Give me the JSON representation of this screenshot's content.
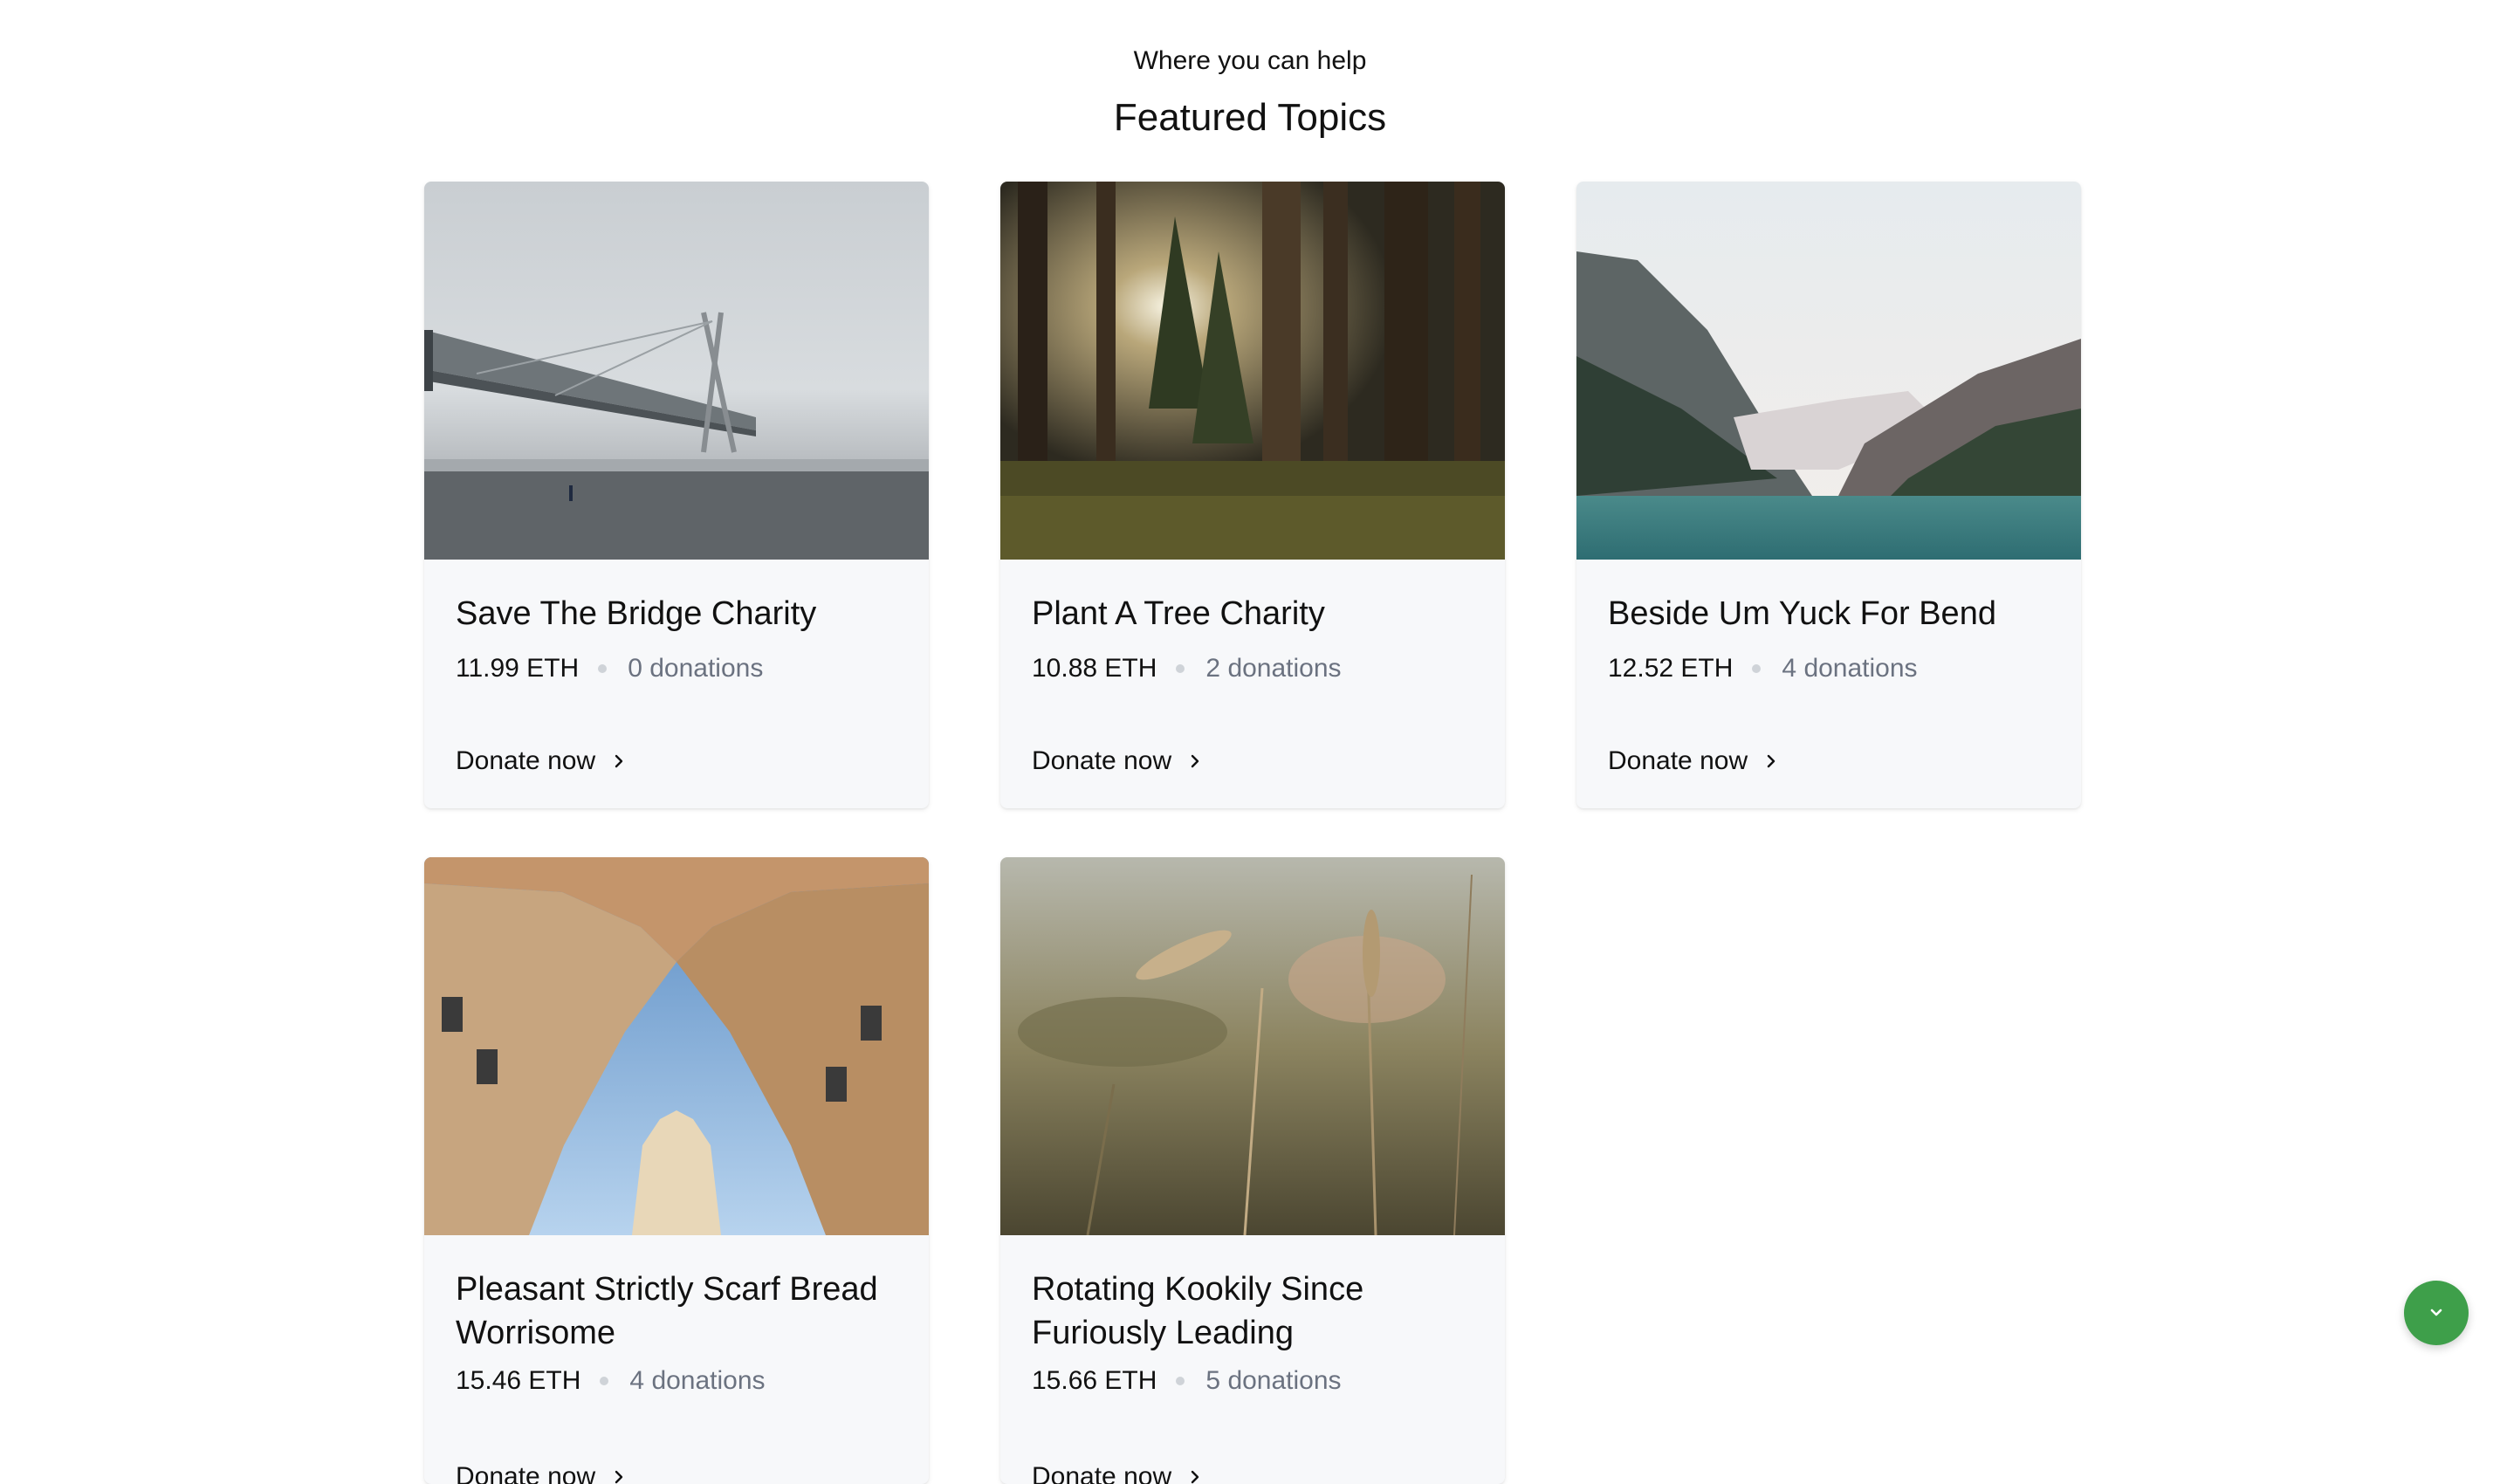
{
  "header": {
    "subtitle": "Where you can help",
    "title": "Featured Topics"
  },
  "cards": [
    {
      "title": "Save The Bridge Charity",
      "amount": "11.99 ETH",
      "donations": "0 donations",
      "cta": "Donate now",
      "image": "foggy-bridge-photo"
    },
    {
      "title": "Plant A Tree Charity",
      "amount": "10.88 ETH",
      "donations": "2 donations",
      "cta": "Donate now",
      "image": "sunlit-forest-photo"
    },
    {
      "title": "Beside Um Yuck For Bend",
      "amount": "12.52 ETH",
      "donations": "4 donations",
      "cta": "Donate now",
      "image": "mountain-lake-photo"
    },
    {
      "title": "Pleasant Strictly Scarf Bread Worrisome",
      "amount": "15.46 ETH",
      "donations": "4 donations",
      "cta": "Donate now",
      "image": "city-buildings-sky-photo"
    },
    {
      "title": "Rotating Kookily Since Furiously Leading",
      "amount": "15.66 ETH",
      "donations": "5 donations",
      "cta": "Donate now",
      "image": "wheat-field-photo"
    }
  ],
  "fab": {
    "icon": "chevron-down-icon",
    "color": "#3e9f4a"
  }
}
